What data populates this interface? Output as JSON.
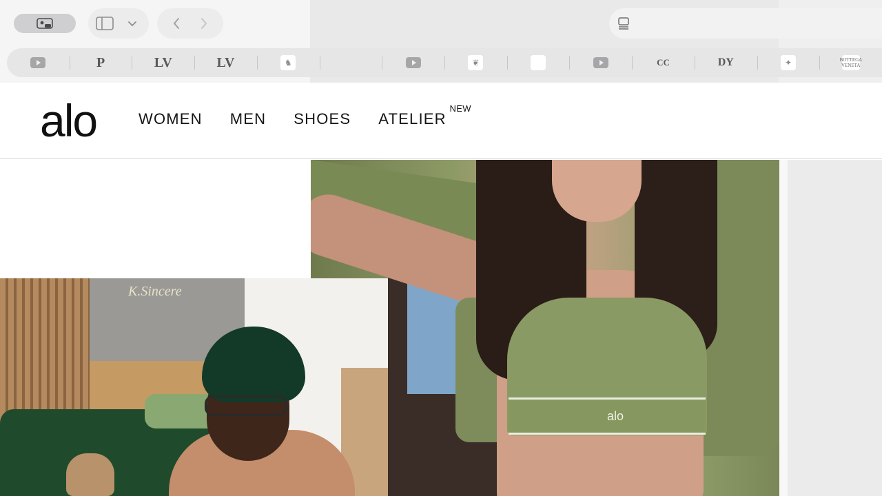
{
  "browser": {
    "bookmarks": [
      {
        "icon": "youtube-icon",
        "glyph": ""
      },
      {
        "icon": "p-logo-icon",
        "glyph": "P"
      },
      {
        "icon": "lv-monogram-icon",
        "glyph": "LV"
      },
      {
        "icon": "lv-monogram-icon",
        "glyph": "LV"
      },
      {
        "icon": "crest-icon",
        "glyph": "♞"
      },
      {
        "icon": "blank-favicon-icon",
        "glyph": ""
      },
      {
        "icon": "youtube-icon",
        "glyph": ""
      },
      {
        "icon": "emblem-icon",
        "glyph": "❦"
      },
      {
        "icon": "map-outline-icon",
        "glyph": ""
      },
      {
        "icon": "youtube-icon",
        "glyph": ""
      },
      {
        "icon": "chanel-icon",
        "glyph": "CC"
      },
      {
        "icon": "dy-monogram-icon",
        "glyph": "DY"
      },
      {
        "icon": "winged-logo-icon",
        "glyph": "✦"
      },
      {
        "icon": "bottega-veneta-icon",
        "glyph": "BOTTEGA VENETA"
      }
    ]
  },
  "site": {
    "logo": "alo",
    "nav": [
      {
        "label": "WOMEN"
      },
      {
        "label": "MEN"
      },
      {
        "label": "SHOES"
      },
      {
        "label": "ATELIER",
        "badge": "NEW"
      }
    ],
    "hero": {
      "band_logo": "alo"
    }
  },
  "webcam": {
    "neon_sign": "K.Sincere"
  },
  "colors": {
    "chrome_bg": "#f5f5f6",
    "brand_text": "#111111",
    "hero_green": "#86975f"
  }
}
